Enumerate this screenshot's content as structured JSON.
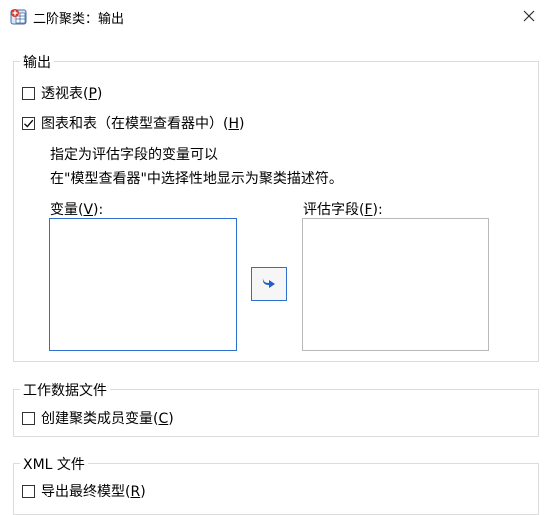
{
  "window": {
    "title": "二阶聚类：输出",
    "app_icon": "spss-table-icon",
    "close_icon": "close-icon"
  },
  "output_group": {
    "legend": "输出",
    "pivot": {
      "label_pre": "透视表(",
      "mnemonic": "P",
      "label_post": ")",
      "checked": false
    },
    "charts": {
      "label_pre": "图表和表（在模型查看器中）(",
      "mnemonic": "H",
      "label_post": ")",
      "checked": true
    },
    "desc_line1": "指定为评估字段的变量可以",
    "desc_line2": "在\"模型查看器\"中选择性地显示为聚类描述符。",
    "variables": {
      "label_pre": "变量(",
      "mnemonic": "V",
      "label_post": "):"
    },
    "eval_fields": {
      "label_pre": "评估字段(",
      "mnemonic": "F",
      "label_post": "):"
    },
    "move_icon": "arrow-right-icon"
  },
  "working_data_group": {
    "legend": "工作数据文件",
    "create_membership": {
      "label_pre": "创建聚类成员变量(",
      "mnemonic": "C",
      "label_post": ")",
      "checked": false
    }
  },
  "xml_group": {
    "legend": "XML 文件",
    "export_final": {
      "label_pre": "导出最终模型(",
      "mnemonic": "R",
      "label_post": ")",
      "checked": false
    }
  }
}
